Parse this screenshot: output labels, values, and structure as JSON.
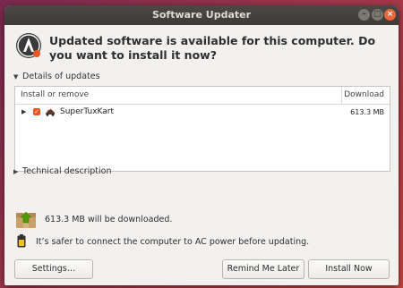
{
  "window": {
    "title": "Software Updater"
  },
  "headline": "Updated software is available for this computer. Do you want to install it now?",
  "details": {
    "expander_label": "Details of updates",
    "columns": [
      "Install or remove",
      "Download"
    ],
    "rows": [
      {
        "name": "SuperTuxKart",
        "size": "613.3 MB",
        "checked": true
      }
    ]
  },
  "technical": {
    "expander_label": "Technical description"
  },
  "download_info": "613.3 MB will be downloaded.",
  "power_notice": "It’s safer to connect the computer to AC power before updating.",
  "buttons": {
    "settings": "Settings…",
    "remind": "Remind Me Later",
    "install": "Install Now"
  },
  "colors": {
    "accent": "#e95420",
    "titlebar": "#3c3b37",
    "close": "#e9663b"
  },
  "icons": {
    "app": "software-updater-icon",
    "package": "supertuxkart-icon",
    "download": "package-download-icon",
    "battery": "battery-icon"
  }
}
